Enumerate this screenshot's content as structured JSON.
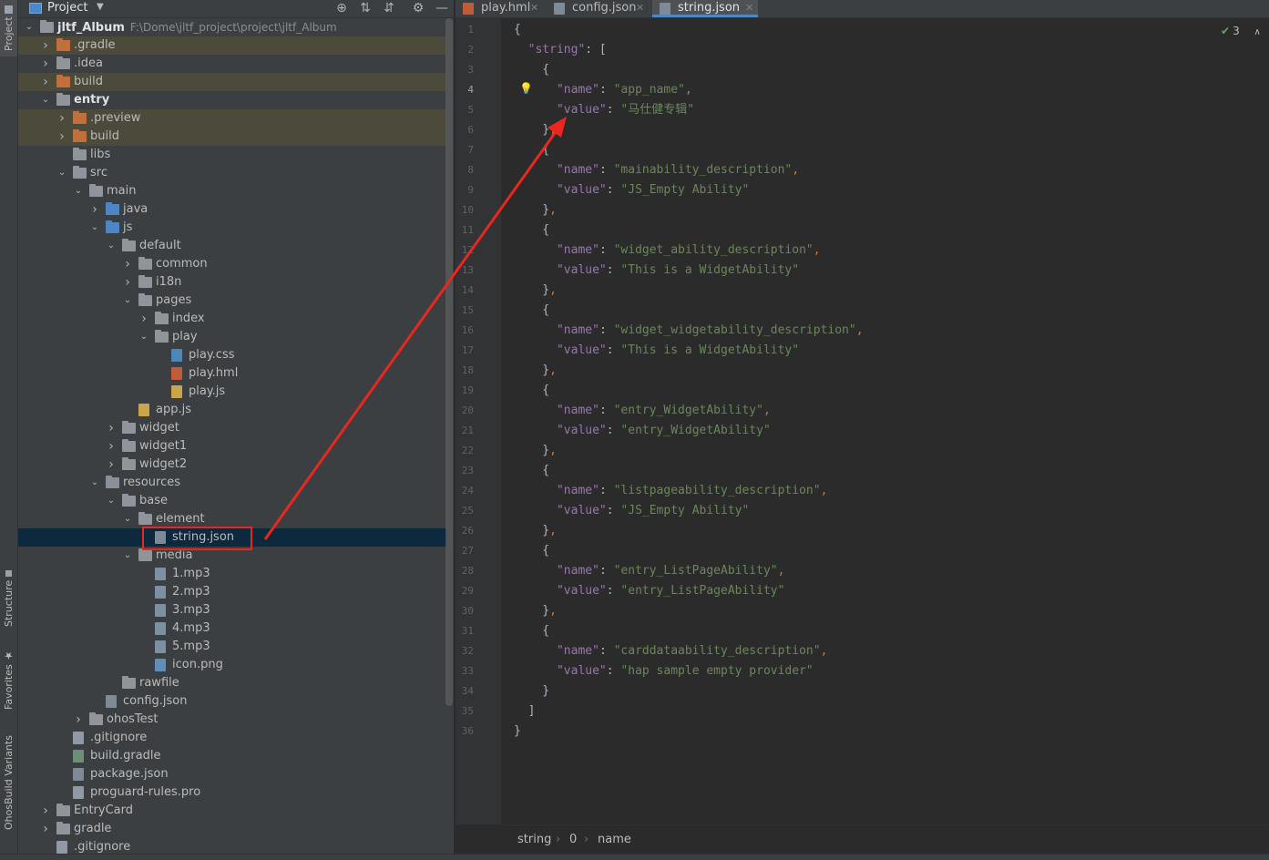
{
  "sidebar": {
    "project": "Project",
    "structure": "Structure",
    "favorites": "Favorites",
    "variants": "OhosBuild Variants"
  },
  "project_panel": {
    "title": "Project",
    "root_name": "jltf_Album",
    "root_path": "F:\\Dome\\jltf_project\\project\\jltf_Album",
    "tree": [
      {
        "label": "jltf_Album",
        "depth": 0,
        "open": true,
        "kind": "module",
        "root": true
      },
      {
        "label": ".gradle",
        "depth": 1,
        "open": false,
        "kind": "folder-orange",
        "excluded": true
      },
      {
        "label": ".idea",
        "depth": 1,
        "open": false,
        "kind": "folder"
      },
      {
        "label": "build",
        "depth": 1,
        "open": false,
        "kind": "folder-orange",
        "excluded": true
      },
      {
        "label": "entry",
        "depth": 1,
        "open": true,
        "kind": "module",
        "bold": true
      },
      {
        "label": ".preview",
        "depth": 2,
        "open": false,
        "kind": "folder-orange",
        "excluded": true
      },
      {
        "label": "build",
        "depth": 2,
        "open": false,
        "kind": "folder-orange",
        "excluded": true
      },
      {
        "label": "libs",
        "depth": 2,
        "kind": "folder"
      },
      {
        "label": "src",
        "depth": 2,
        "open": true,
        "kind": "folder"
      },
      {
        "label": "main",
        "depth": 3,
        "open": true,
        "kind": "folder"
      },
      {
        "label": "java",
        "depth": 4,
        "open": false,
        "kind": "folder-blue"
      },
      {
        "label": "js",
        "depth": 4,
        "open": true,
        "kind": "folder-blue"
      },
      {
        "label": "default",
        "depth": 5,
        "open": true,
        "kind": "folder"
      },
      {
        "label": "common",
        "depth": 6,
        "open": false,
        "kind": "folder"
      },
      {
        "label": "i18n",
        "depth": 6,
        "open": false,
        "kind": "folder"
      },
      {
        "label": "pages",
        "depth": 6,
        "open": true,
        "kind": "folder"
      },
      {
        "label": "index",
        "depth": 7,
        "open": false,
        "kind": "folder"
      },
      {
        "label": "play",
        "depth": 7,
        "open": true,
        "kind": "folder"
      },
      {
        "label": "play.css",
        "depth": 8,
        "kind": "file-css"
      },
      {
        "label": "play.hml",
        "depth": 8,
        "kind": "file-hml"
      },
      {
        "label": "play.js",
        "depth": 8,
        "kind": "file-js"
      },
      {
        "label": "app.js",
        "depth": 6,
        "kind": "file-js"
      },
      {
        "label": "widget",
        "depth": 5,
        "open": false,
        "kind": "folder"
      },
      {
        "label": "widget1",
        "depth": 5,
        "open": false,
        "kind": "folder"
      },
      {
        "label": "widget2",
        "depth": 5,
        "open": false,
        "kind": "folder"
      },
      {
        "label": "resources",
        "depth": 4,
        "open": true,
        "kind": "folder-res"
      },
      {
        "label": "base",
        "depth": 5,
        "open": true,
        "kind": "folder"
      },
      {
        "label": "element",
        "depth": 6,
        "open": true,
        "kind": "folder"
      },
      {
        "label": "string.json",
        "depth": 7,
        "kind": "file-json",
        "selected": true
      },
      {
        "label": "media",
        "depth": 6,
        "open": true,
        "kind": "folder"
      },
      {
        "label": "1.mp3",
        "depth": 7,
        "kind": "file-mp3"
      },
      {
        "label": "2.mp3",
        "depth": 7,
        "kind": "file-mp3"
      },
      {
        "label": "3.mp3",
        "depth": 7,
        "kind": "file-mp3"
      },
      {
        "label": "4.mp3",
        "depth": 7,
        "kind": "file-mp3"
      },
      {
        "label": "5.mp3",
        "depth": 7,
        "kind": "file-mp3"
      },
      {
        "label": "icon.png",
        "depth": 7,
        "kind": "file-png"
      },
      {
        "label": "rawfile",
        "depth": 5,
        "kind": "folder"
      },
      {
        "label": "config.json",
        "depth": 4,
        "kind": "file-json"
      },
      {
        "label": "ohosTest",
        "depth": 3,
        "open": false,
        "kind": "folder"
      },
      {
        "label": ".gitignore",
        "depth": 2,
        "kind": "file"
      },
      {
        "label": "build.gradle",
        "depth": 2,
        "kind": "file-gradle"
      },
      {
        "label": "package.json",
        "depth": 2,
        "kind": "file-json"
      },
      {
        "label": "proguard-rules.pro",
        "depth": 2,
        "kind": "file"
      },
      {
        "label": "EntryCard",
        "depth": 1,
        "open": false,
        "kind": "folder"
      },
      {
        "label": "gradle",
        "depth": 1,
        "open": false,
        "kind": "folder"
      },
      {
        "label": ".gitignore",
        "depth": 1,
        "kind": "file"
      }
    ]
  },
  "tabs": [
    {
      "label": "play.hml",
      "kind": "hml",
      "active": false
    },
    {
      "label": "config.json",
      "kind": "json",
      "active": false
    },
    {
      "label": "string.json",
      "kind": "json",
      "active": true
    }
  ],
  "editor": {
    "current_line": 4,
    "inspection_count": "3",
    "lines": [
      "{",
      "  \"string\": [",
      "    {",
      "      \"name\": \"app_name\",",
      "      \"value\": \"马仕健专辑\"",
      "    },",
      "    {",
      "      \"name\": \"mainability_description\",",
      "      \"value\": \"JS_Empty Ability\"",
      "    },",
      "    {",
      "      \"name\": \"widget_ability_description\",",
      "      \"value\": \"This is a WidgetAbility\"",
      "    },",
      "    {",
      "      \"name\": \"widget_widgetability_description\",",
      "      \"value\": \"This is a WidgetAbility\"",
      "    },",
      "    {",
      "      \"name\": \"entry_WidgetAbility\",",
      "      \"value\": \"entry_WidgetAbility\"",
      "    },",
      "    {",
      "      \"name\": \"listpageability_description\",",
      "      \"value\": \"JS_Empty Ability\"",
      "    },",
      "    {",
      "      \"name\": \"entry_ListPageAbility\",",
      "      \"value\": \"entry_ListPageAbility\"",
      "    },",
      "    {",
      "      \"name\": \"carddataability_description\",",
      "      \"value\": \"hap sample empty provider\"",
      "    }",
      "  ]",
      "}"
    ]
  },
  "breadcrumb": [
    "string",
    "0",
    "name"
  ],
  "colors": {
    "key": "#9876aa",
    "string": "#6a8759",
    "punct": "#cc7832",
    "annotation": "#e8281e",
    "selection": "#0d293e"
  }
}
